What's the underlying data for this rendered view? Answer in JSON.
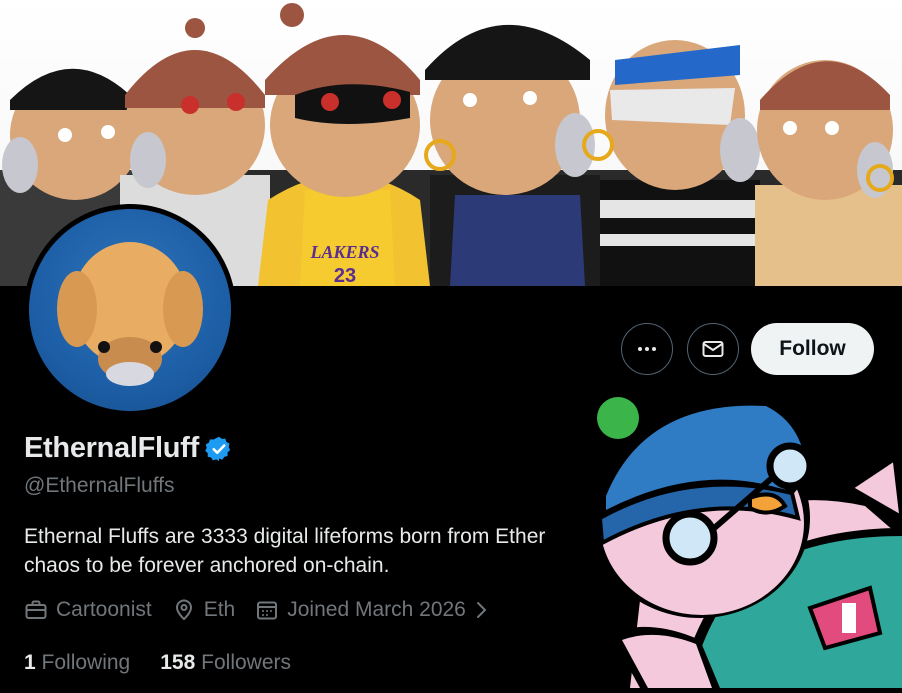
{
  "profile": {
    "display_name": "EthernalFluff",
    "handle": "@EthernalFluffs",
    "bio": "Ethernal Fluffs are 3333 digital lifeforms born from Ether\nchaos to be forever anchored on-chain.",
    "category": "Cartoonist",
    "location": "Eth",
    "joined": "Joined March 2026",
    "following_count": "1",
    "following_label": "Following",
    "followers_count": "158",
    "followers_label": "Followers"
  },
  "actions": {
    "follow_label": "Follow",
    "more_icon": "more-horizontal-icon",
    "message_icon": "envelope-icon"
  },
  "banner_text": {
    "jersey": "LAKERS",
    "jersey_number": "23"
  },
  "colors": {
    "background": "#000000",
    "primary_text": "#e7e9ea",
    "secondary_text": "#71767b",
    "verified_blue": "#1d9bf0",
    "follow_button_bg": "#eff3f4"
  }
}
